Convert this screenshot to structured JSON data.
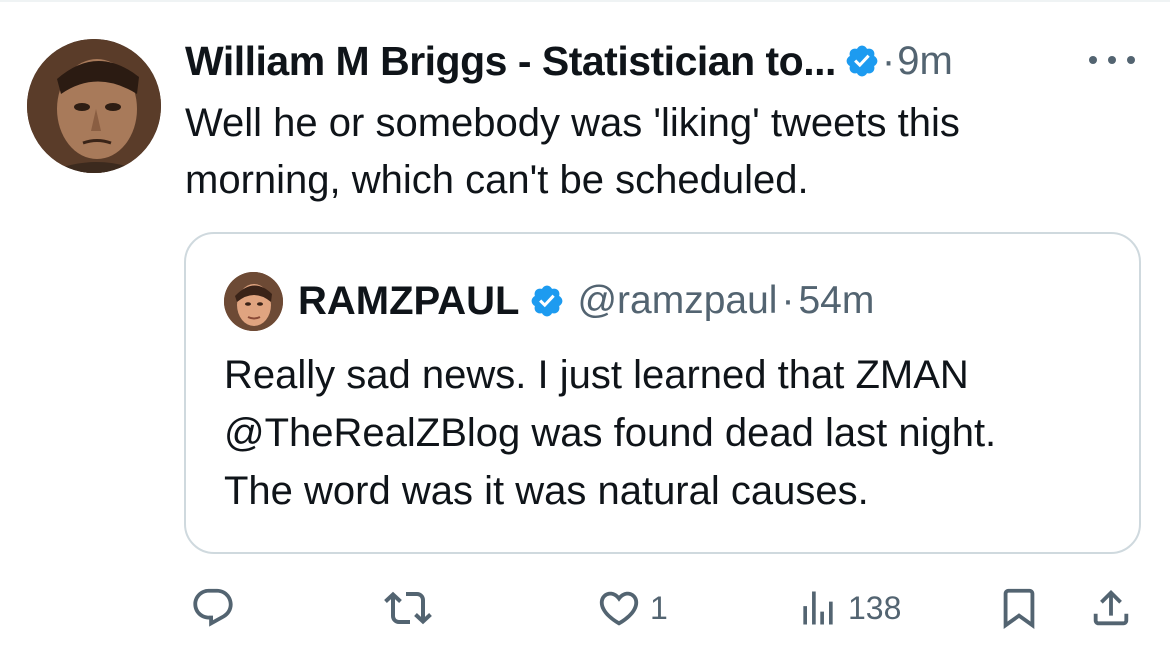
{
  "tweet": {
    "author_name": "William M Briggs - Statistician to...",
    "separator": "·",
    "timestamp": "9m",
    "text_lines": [
      "Well he or somebody was 'liking' tweets this",
      "morning, which can't be scheduled."
    ]
  },
  "quote": {
    "author_name": "RAMZPAUL",
    "handle": "@ramzpaul",
    "separator": "·",
    "timestamp": "54m",
    "text": "Really sad news. I just learned that ZMAN\n@TheRealZBlog  was found dead last night.\nThe word was it was natural causes."
  },
  "actions": {
    "reply_count": "",
    "retweet_count": "",
    "like_count": "1",
    "views_count": "138"
  },
  "icons": {
    "verified": "verified-badge-icon",
    "more": "more-options-icon",
    "reply": "reply-icon",
    "retweet": "retweet-icon",
    "like": "heart-icon",
    "views": "views-icon",
    "bookmark": "bookmark-icon",
    "share": "share-icon"
  },
  "colors": {
    "verified_blue": "#1d9bf0",
    "text_primary": "#0f1419",
    "text_secondary": "#536471",
    "border": "#cfd9de"
  }
}
